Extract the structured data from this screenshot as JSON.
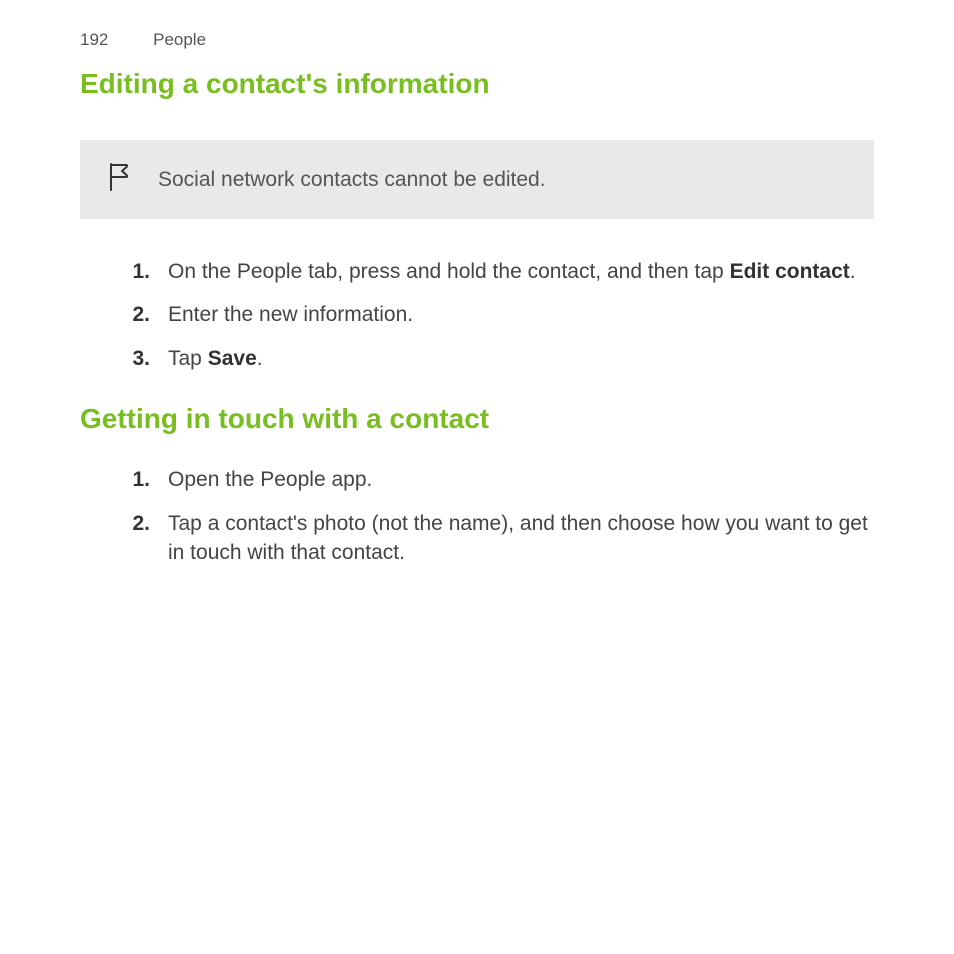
{
  "header": {
    "page_number": "192",
    "section_name": "People"
  },
  "section1": {
    "title": "Editing a contact's information",
    "note": "Social network contacts cannot be edited.",
    "steps": [
      {
        "num": "1.",
        "pre": "On the People tab, press and hold the contact, and then tap ",
        "bold": "Edit contact",
        "post": "."
      },
      {
        "num": "2.",
        "pre": "Enter the new information.",
        "bold": "",
        "post": ""
      },
      {
        "num": "3.",
        "pre": "Tap ",
        "bold": "Save",
        "post": "."
      }
    ]
  },
  "section2": {
    "title": "Getting in touch with a contact",
    "steps": [
      {
        "num": "1.",
        "pre": "Open the People app.",
        "bold": "",
        "post": ""
      },
      {
        "num": "2.",
        "pre": "Tap a contact's photo (not the name), and then choose how you want to get in touch with that contact.",
        "bold": "",
        "post": ""
      }
    ]
  }
}
